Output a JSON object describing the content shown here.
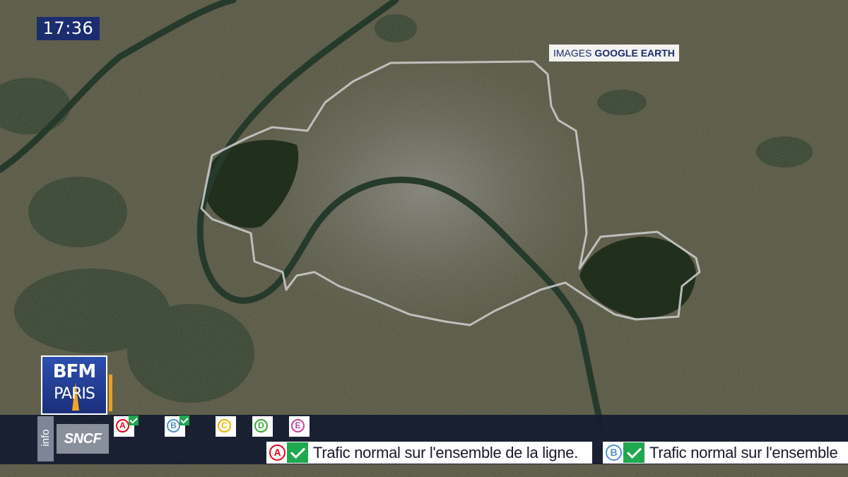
{
  "header": {
    "clock": "17:36"
  },
  "credit": {
    "prefix": "IMAGES",
    "brand": "GOOGLE EARTH"
  },
  "logo": {
    "line1": "BFM",
    "line2": "PARIS"
  },
  "ticker": {
    "label": "info",
    "operator": "SNCF",
    "lines": [
      {
        "id": "A",
        "color": "#e3051b",
        "ok": true
      },
      {
        "id": "B",
        "color": "#5291ce",
        "ok": true
      },
      {
        "id": "C",
        "color": "#f0b200",
        "ok": false
      },
      {
        "id": "D",
        "color": "#3aa935",
        "ok": false
      },
      {
        "id": "E",
        "color": "#c6479c",
        "ok": false
      }
    ],
    "messages": [
      {
        "line": "A",
        "color": "#e3051b",
        "text": "Trafic normal sur l'ensemble de la ligne."
      },
      {
        "line": "B",
        "color": "#5291ce",
        "text": "Trafic normal sur l'ensemble"
      }
    ],
    "status_color": "#1fa84f"
  },
  "map": {
    "colors": {
      "ground": "#4a4a36",
      "urban": "#6e6e66",
      "forest": "#22331f",
      "river": "#263a2c",
      "boundary": "#c9c9c9"
    },
    "features": [
      "paris-boundary",
      "bois-de-boulogne",
      "bois-de-vincennes",
      "seine-river"
    ]
  }
}
